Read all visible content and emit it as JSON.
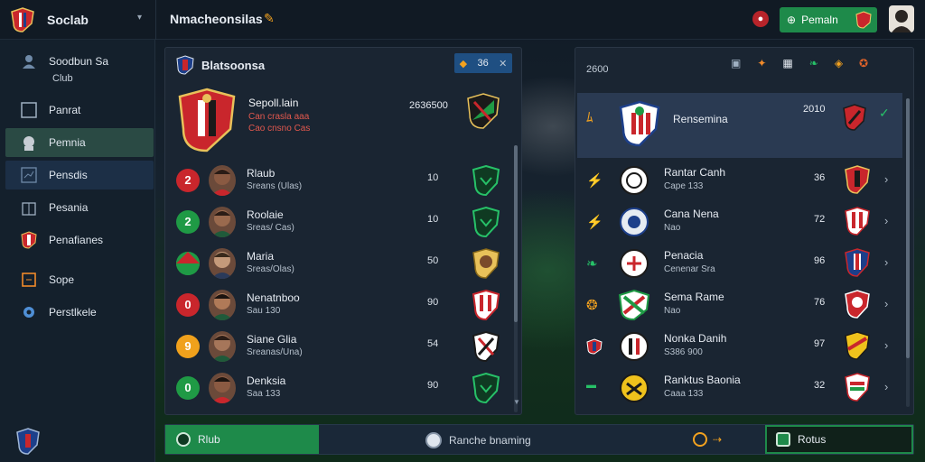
{
  "topbar": {
    "brand": "Soclab",
    "heading": "Nmacheonsilas",
    "premium_label": "Pemaln"
  },
  "sidebar": {
    "items": [
      {
        "label": "Soodbun Sa",
        "icon": "person-icon"
      },
      {
        "label": "Panrat",
        "icon": "square-icon"
      },
      {
        "label": "Pemnia",
        "icon": "face-icon"
      },
      {
        "label": "Pensdis",
        "icon": "chart-icon"
      },
      {
        "label": "Pesania",
        "icon": "building-icon"
      },
      {
        "label": "Penafianes",
        "icon": "shield-icon"
      },
      {
        "label": "Sope",
        "icon": "box-icon"
      },
      {
        "label": "Perstlkele",
        "icon": "gear-icon"
      }
    ],
    "sub_label": "Club"
  },
  "left_panel": {
    "title": "Blatsoonsa",
    "chip_value": "36",
    "featured": {
      "name": "Sepoll.lain",
      "sub1": "Can crasla aaa",
      "sub2": "Cao cnsno Cas",
      "score": "2636500"
    },
    "rows": [
      {
        "rank": "2",
        "name": "Rlaub",
        "sub": "Sreans (Ulas)",
        "value": "10",
        "rank_color": "#c9262c"
      },
      {
        "rank": "2",
        "name": "Roolaie",
        "sub": "Sreas/ Cas)",
        "value": "10",
        "rank_color": "#1f9a45"
      },
      {
        "rank": "",
        "name": "Maria",
        "sub": "Sreas/Olas)",
        "value": "50",
        "rank_color": "#1f9a45"
      },
      {
        "rank": "0",
        "name": "Nenatnboo",
        "sub": "Sau 130",
        "value": "90",
        "rank_color": "#c9262c"
      },
      {
        "rank": "9",
        "name": "Siane Glia",
        "sub": "Sreanas/Una)",
        "value": "54",
        "rank_color": "#f0a11c"
      },
      {
        "rank": "0",
        "name": "Denksia",
        "sub": "Saa 133",
        "value": "90",
        "rank_color": "#1f9a45"
      }
    ]
  },
  "right_panel": {
    "head": "2600",
    "featured": {
      "name": "Rensemina",
      "value": "2010"
    },
    "rows": [
      {
        "name": "Rantar Canh",
        "sub": "Cape 133",
        "value": "36"
      },
      {
        "name": "Cana Nena",
        "sub": "Nao",
        "value": "72"
      },
      {
        "name": "Penacia",
        "sub": "Cenenar Sra",
        "value": "96"
      },
      {
        "name": "Sema Rame",
        "sub": "Nao",
        "value": "76"
      },
      {
        "name": "Nonka Danih",
        "sub": "S386 900",
        "value": "97"
      },
      {
        "name": "Ranktus Baonia",
        "sub": "Caaa 133",
        "value": "32"
      }
    ]
  },
  "bottombar": {
    "club": "Rlub",
    "middle": "Ranche bnaming",
    "setup": "Rotus"
  }
}
